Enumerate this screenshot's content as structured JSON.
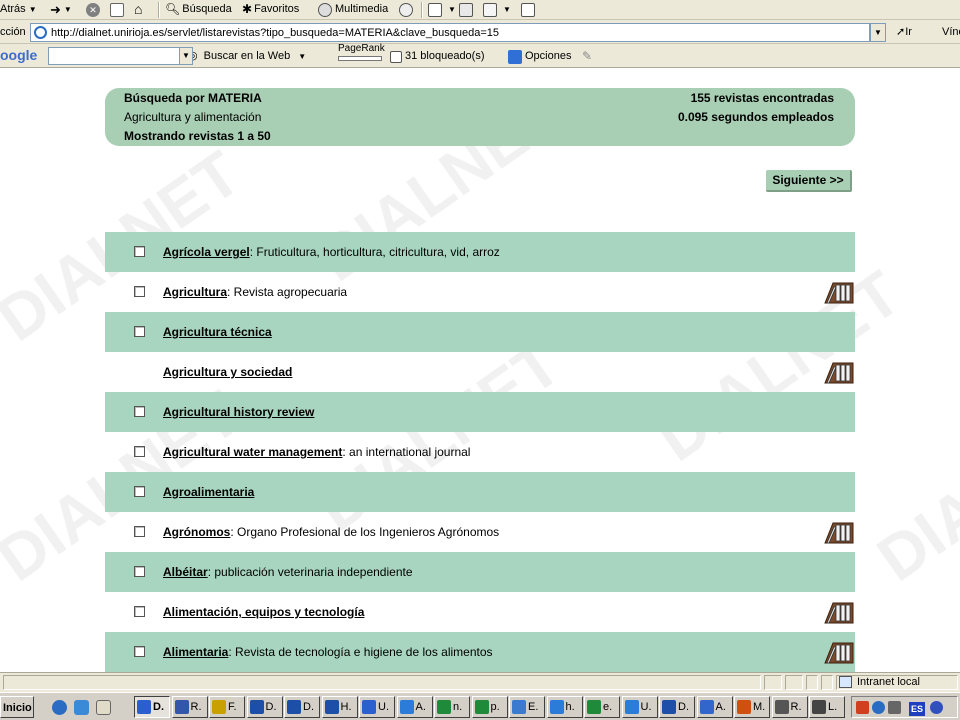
{
  "browser": {
    "toolbar": {
      "back": "Atrás",
      "search": "Búsqueda",
      "favorites": "Favoritos",
      "media": "Multimedia"
    },
    "address": {
      "label": "cción",
      "url": "http://dialnet.unirioja.es/servlet/listarevistas?tipo_busqueda=MATERIA&clave_busqueda=15",
      "go": "Ir",
      "links": "Vínc"
    },
    "google_bar": {
      "logo": "oogle",
      "search_web": "Buscar en la Web",
      "pagerank": "PageRank",
      "blocked": "31 bloqueado(s)",
      "options": "Opciones"
    }
  },
  "page": {
    "watermark": "DIALNET",
    "summary": {
      "search_by": "Búsqueda por MATERIA",
      "subject": "Agricultura y alimentación",
      "showing": "Mostrando revistas 1 a 50",
      "found": "155 revistas encontradas",
      "time": "0.095 segundos empleados"
    },
    "next_button": "Siguiente >>",
    "journals": [
      {
        "title": "Agrícola vergel",
        "subtitle": ": Fruticultura, horticultura, citricultura, vid, arroz",
        "checkbox": true,
        "library_icon": false
      },
      {
        "title": "Agricultura",
        "subtitle": ": Revista agropecuaria",
        "checkbox": true,
        "library_icon": true
      },
      {
        "title": "Agricultura técnica",
        "subtitle": "",
        "checkbox": true,
        "library_icon": false
      },
      {
        "title": "Agricultura y sociedad",
        "subtitle": "",
        "checkbox": false,
        "library_icon": true
      },
      {
        "title": "Agricultural history review",
        "subtitle": "",
        "checkbox": true,
        "library_icon": false
      },
      {
        "title": "Agricultural water management",
        "subtitle": ": an international journal",
        "checkbox": true,
        "library_icon": false
      },
      {
        "title": "Agroalimentaria",
        "subtitle": "",
        "checkbox": true,
        "library_icon": false
      },
      {
        "title": "Agrónomos",
        "subtitle": ": Organo Profesional de los Ingenieros Agrónomos",
        "checkbox": true,
        "library_icon": true
      },
      {
        "title": "Albéitar",
        "subtitle": ": publicación veterinaria independiente",
        "checkbox": true,
        "library_icon": false
      },
      {
        "title": "Alimentación, equipos y tecnología",
        "subtitle": "",
        "checkbox": true,
        "library_icon": true
      },
      {
        "title": "Alimentaria",
        "subtitle": ": Revista de tecnología e higiene de los alimentos",
        "checkbox": true,
        "library_icon": true
      }
    ]
  },
  "status_bar": {
    "zone": "Intranet local"
  },
  "taskbar": {
    "start": "Inicio",
    "tasks": [
      {
        "label": "D.",
        "icon_color": "#2b5fd0",
        "active": true
      },
      {
        "label": "R.",
        "icon_color": "#3355aa",
        "active": false
      },
      {
        "label": "F.",
        "icon_color": "#c8a000",
        "active": false
      },
      {
        "label": "D.",
        "icon_color": "#1e4fa8",
        "active": false
      },
      {
        "label": "D.",
        "icon_color": "#1e4fa8",
        "active": false
      },
      {
        "label": "H.",
        "icon_color": "#1e4fa8",
        "active": false
      },
      {
        "label": "U.",
        "icon_color": "#2b5fd0",
        "active": false
      },
      {
        "label": "A.",
        "icon_color": "#2b7bd8",
        "active": false
      },
      {
        "label": "n.",
        "icon_color": "#1f8a3a",
        "active": false
      },
      {
        "label": "p.",
        "icon_color": "#1f8a3a",
        "active": false
      },
      {
        "label": "E.",
        "icon_color": "#3a7bd0",
        "active": false
      },
      {
        "label": "h.",
        "icon_color": "#2b7bd8",
        "active": false
      },
      {
        "label": "e.",
        "icon_color": "#1f8a3a",
        "active": false
      },
      {
        "label": "U.",
        "icon_color": "#2b7bd8",
        "active": false
      },
      {
        "label": "D.",
        "icon_color": "#1e4fa8",
        "active": false
      },
      {
        "label": "A.",
        "icon_color": "#3366cc",
        "active": false
      },
      {
        "label": "M.",
        "icon_color": "#d05010",
        "active": false
      },
      {
        "label": "R.",
        "icon_color": "#555555",
        "active": false
      },
      {
        "label": "L.",
        "icon_color": "#444444",
        "active": false
      }
    ],
    "language": "ES"
  },
  "colors": {
    "row_shade": "#a8d5c0",
    "panel": "#a8cfb4",
    "chrome": "#ece9d8"
  }
}
